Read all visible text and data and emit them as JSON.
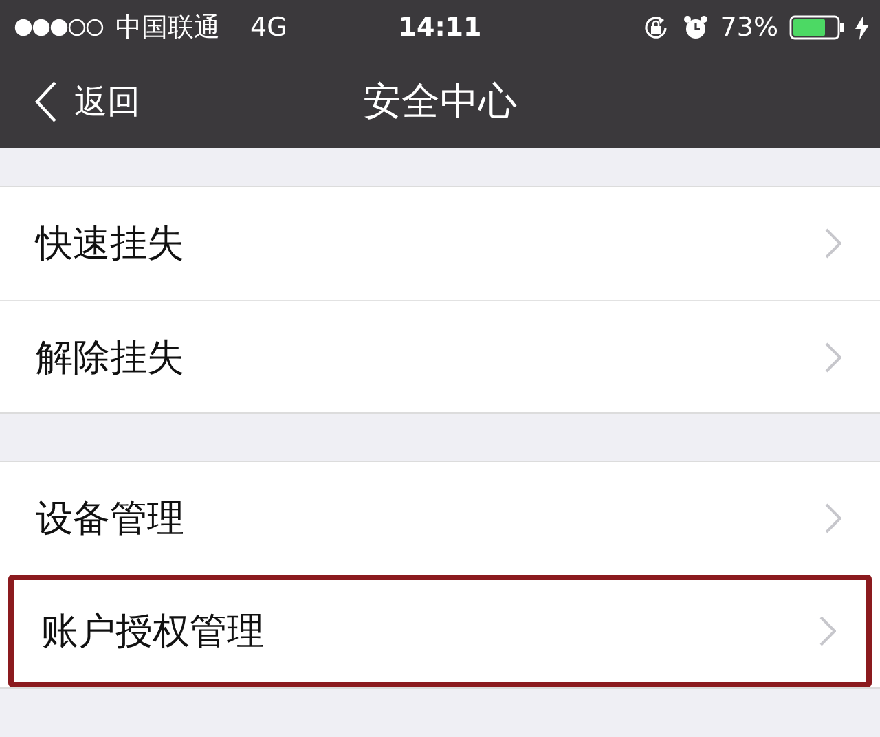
{
  "status_bar": {
    "carrier": "中国联通",
    "network": "4G",
    "time": "14:11",
    "battery": "73%"
  },
  "nav_bar": {
    "back": "返回",
    "title": "安全中心"
  },
  "groups": [
    {
      "items": [
        {
          "label": "快速挂失",
          "highlighted": false
        },
        {
          "label": "解除挂失",
          "highlighted": false
        }
      ]
    },
    {
      "items": [
        {
          "label": "设备管理",
          "highlighted": false
        },
        {
          "label": "账户授权管理",
          "highlighted": true
        }
      ]
    }
  ]
}
